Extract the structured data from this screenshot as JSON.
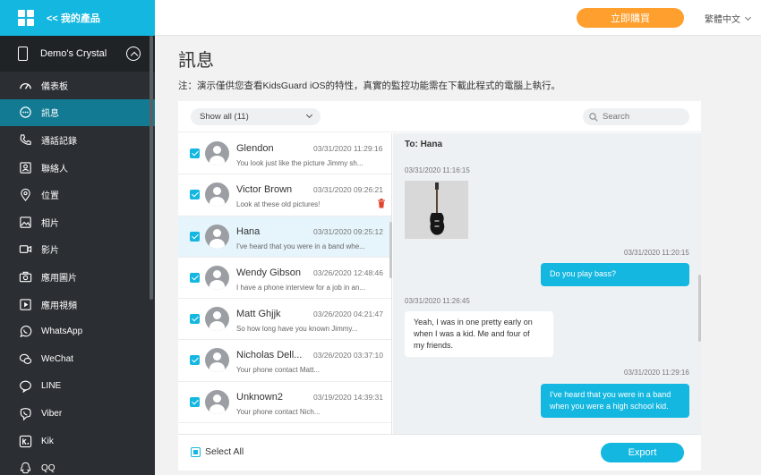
{
  "sidebar": {
    "back_label": "<< 我的產品",
    "device_name": "Demo's Crystal",
    "items": [
      {
        "label": "儀表板",
        "icon": "dashboard-icon",
        "active": false
      },
      {
        "label": "訊息",
        "icon": "message-icon",
        "active": true
      },
      {
        "label": "通話記錄",
        "icon": "phone-icon",
        "active": false
      },
      {
        "label": "聯絡人",
        "icon": "contacts-icon",
        "active": false
      },
      {
        "label": "位置",
        "icon": "location-icon",
        "active": false
      },
      {
        "label": "相片",
        "icon": "photo-icon",
        "active": false
      },
      {
        "label": "影片",
        "icon": "video-icon",
        "active": false
      },
      {
        "label": "應用圖片",
        "icon": "camera-icon",
        "active": false
      },
      {
        "label": "應用視頻",
        "icon": "play-icon",
        "active": false
      },
      {
        "label": "WhatsApp",
        "icon": "whatsapp-icon",
        "active": false
      },
      {
        "label": "WeChat",
        "icon": "wechat-icon",
        "active": false
      },
      {
        "label": "LINE",
        "icon": "line-icon",
        "active": false
      },
      {
        "label": "Viber",
        "icon": "viber-icon",
        "active": false
      },
      {
        "label": "Kik",
        "icon": "kik-icon",
        "active": false
      },
      {
        "label": "QQ",
        "icon": "qq-icon",
        "active": false
      }
    ]
  },
  "topbar": {
    "buy_label": "立即購買",
    "language": "繁體中文"
  },
  "page": {
    "title": "訊息",
    "notice": "注：演示僅供您查看KidsGuard iOS的特性，真實的監控功能需在下載此程式的電腦上執行。"
  },
  "filter": {
    "label": "Show all (11)"
  },
  "search": {
    "placeholder": "Search"
  },
  "conversations": [
    {
      "name": "Glendon",
      "date": "03/31/2020 11:29:16",
      "snippet": "You look just like the picture Jimmy sh...",
      "checked": true
    },
    {
      "name": "Victor Brown",
      "date": "03/31/2020 09:26:21",
      "snippet": "Look at these old pictures!",
      "checked": true
    },
    {
      "name": "Hana",
      "date": "03/31/2020 09:25:12",
      "snippet": "I've heard that you were in a band whe...",
      "checked": true
    },
    {
      "name": "Wendy Gibson",
      "date": "03/26/2020 12:48:46",
      "snippet": "I have a phone interview for a job in an...",
      "checked": true
    },
    {
      "name": "Matt Ghjjk",
      "date": "03/26/2020 04:21:47",
      "snippet": "So how long have you known Jimmy...",
      "checked": true
    },
    {
      "name": "Nicholas Dell...",
      "date": "03/26/2020 03:37:10",
      "snippet": "Your phone contact Matt...",
      "checked": true
    },
    {
      "name": "Unknown2",
      "date": "03/19/2020 14:39:31",
      "snippet": "Your phone contact Nich...",
      "checked": true
    }
  ],
  "chat": {
    "to_label": "To: Hana",
    "messages": [
      {
        "time": "03/31/2020 11:16:15",
        "direction": "in",
        "type": "image",
        "icon": "bass-guitar-icon"
      },
      {
        "time": "03/31/2020 11:20:15",
        "direction": "out",
        "type": "text",
        "text": "Do you play bass?"
      },
      {
        "time": "03/31/2020 11:26:45",
        "direction": "in",
        "type": "text",
        "lines": [
          "Yeah, I was in one pretty early on",
          "when I was a kid. Me and four of",
          "my friends."
        ]
      },
      {
        "time": "03/31/2020 11:29:16",
        "direction": "out",
        "type": "text",
        "lines": [
          "I've heard that you were in a band",
          "when you were a high school kid."
        ]
      }
    ]
  },
  "footer": {
    "select_all": "Select All",
    "export": "Export"
  },
  "colors": {
    "accent": "#14b7e0",
    "sidebar_bg": "#2b2f33",
    "sidebar_active": "#127a92",
    "buy_orange": "#ff9f2e"
  }
}
